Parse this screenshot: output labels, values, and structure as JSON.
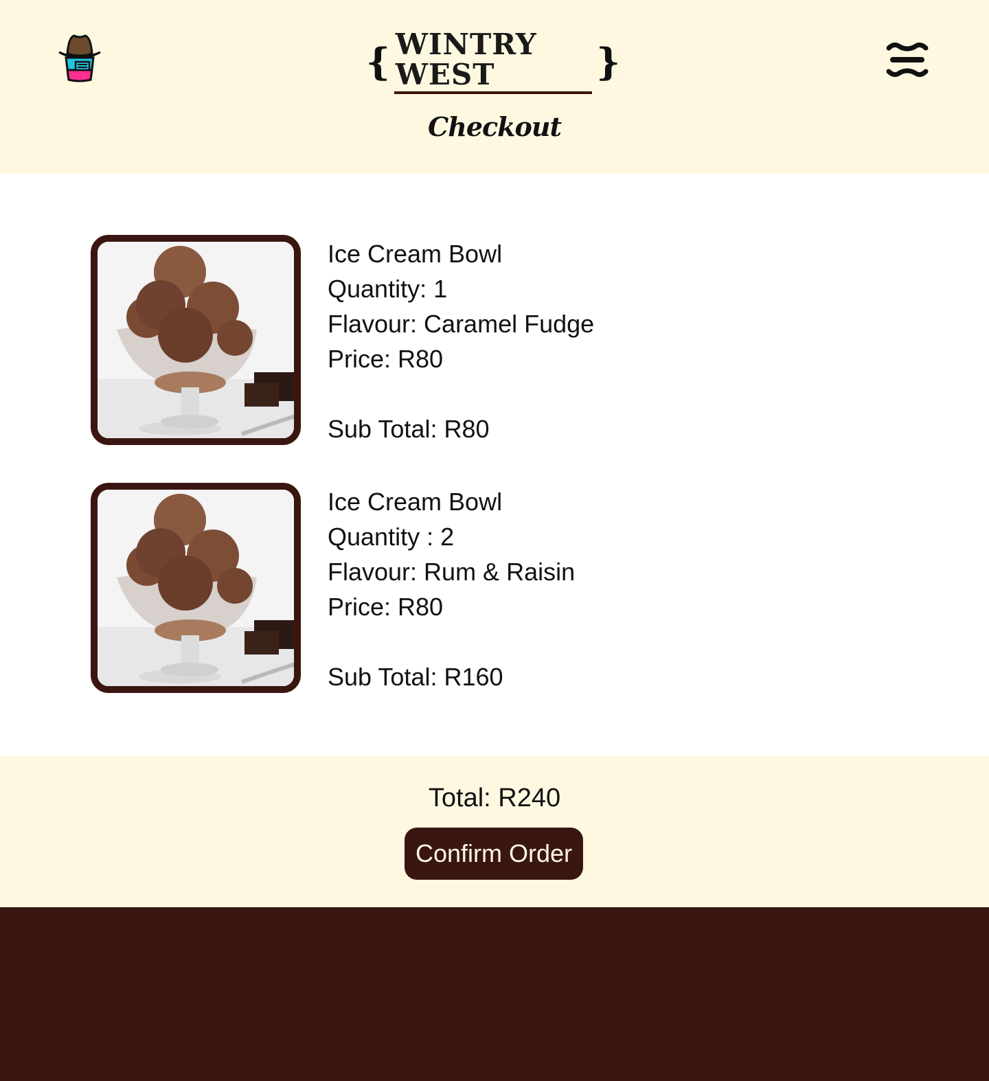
{
  "header": {
    "brand_left_brace": "{",
    "brand_name": "WINTRY WEST",
    "brand_right_brace": "}",
    "page_title": "Checkout",
    "logo_icon": "cowboy-hat-cup-icon",
    "menu_icon": "hamburger-menu-icon"
  },
  "cart": {
    "items": [
      {
        "name": "Ice Cream Bowl",
        "quantity": "Quantity: 1",
        "flavour": "Flavour: Caramel Fudge",
        "price": "Price: R80",
        "subtotal": "Sub Total: R80",
        "image": "chocolate-ice-cream-bowl-image"
      },
      {
        "name": "Ice Cream Bowl",
        "quantity": "Quantity : 2",
        "flavour": "Flavour: Rum & Raisin",
        "price": "Price: R80",
        "subtotal": "Sub Total: R160",
        "image": "chocolate-ice-cream-bowl-image"
      }
    ]
  },
  "summary": {
    "total": "Total: R240",
    "confirm_label": "Confirm Order"
  },
  "colors": {
    "cream": "#fff8e1",
    "brown": "#3a1610",
    "white": "#ffffff"
  }
}
